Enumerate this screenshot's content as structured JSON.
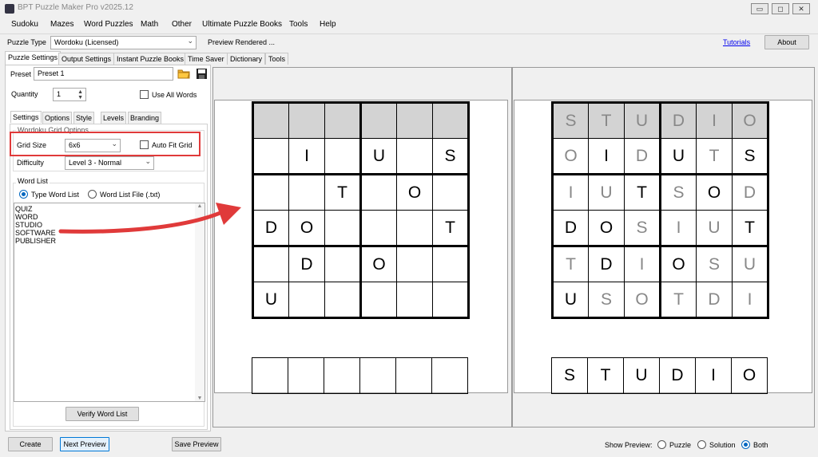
{
  "window": {
    "title": "BPT Puzzle Maker Pro v2025.12",
    "minimize": "▭",
    "maximize": "◻",
    "close": "✕"
  },
  "menu": [
    "Sudoku",
    "Mazes",
    "Word Puzzles",
    "Math",
    "Other",
    "Ultimate Puzzle Books",
    "Tools",
    "Help"
  ],
  "toolbar": {
    "puzzle_type_label": "Puzzle Type",
    "puzzle_type_value": "Wordoku (Licensed)",
    "preview_status": "Preview Rendered ...",
    "tutorials_link": "Tutorials",
    "about_button": "About"
  },
  "tabs": [
    "Puzzle Settings",
    "Output Settings",
    "Instant Puzzle Books",
    "Time Saver",
    "Dictionary",
    "Tools"
  ],
  "settings": {
    "preset_label": "Preset",
    "preset_value": "Preset 1",
    "quantity_label": "Quantity",
    "quantity_value": "1",
    "use_all_words": "Use All Words",
    "subtabs": [
      "Settings",
      "Options",
      "Style",
      "Levels",
      "Branding"
    ],
    "grid_options_title": "Wordoku Grid Options",
    "grid_size_label": "Grid Size",
    "grid_size_value": "6x6",
    "auto_fit_grid": "Auto Fit Grid",
    "difficulty_label": "Difficulty",
    "difficulty_value": "Level 3 - Normal",
    "word_list_title": "Word List",
    "type_word_list": "Type Word List",
    "word_list_file": "Word List File (.txt)",
    "words": [
      "QUIZ",
      "WORD",
      "STUDIO",
      "SOFTWARE",
      "PUBLISHER"
    ],
    "verify_button": "Verify Word List"
  },
  "puzzle": {
    "header_row": [
      "",
      "",
      "",
      "",
      "",
      ""
    ],
    "rows": [
      [
        "",
        "I",
        "",
        "U",
        "",
        "S"
      ],
      [
        "",
        "",
        "T",
        "",
        "O",
        ""
      ],
      [
        "D",
        "O",
        "",
        "",
        "",
        "T"
      ],
      [
        "",
        "D",
        "",
        "O",
        "",
        ""
      ],
      [
        "U",
        "",
        "",
        "",
        "",
        ""
      ]
    ],
    "answer_row": [
      "",
      "",
      "",
      "",
      "",
      ""
    ]
  },
  "solution": {
    "header_row": [
      "S",
      "T",
      "U",
      "D",
      "I",
      "O"
    ],
    "rows": [
      [
        "O",
        "I",
        "D",
        "U",
        "T",
        "S"
      ],
      [
        "I",
        "U",
        "T",
        "S",
        "O",
        "D"
      ],
      [
        "D",
        "O",
        "S",
        "I",
        "U",
        "T"
      ],
      [
        "T",
        "D",
        "I",
        "O",
        "S",
        "U"
      ],
      [
        "U",
        "S",
        "O",
        "T",
        "D",
        "I"
      ]
    ],
    "given_mask": [
      [
        0,
        1,
        0,
        1,
        0,
        1
      ],
      [
        0,
        0,
        1,
        0,
        1,
        0
      ],
      [
        1,
        1,
        0,
        0,
        0,
        1
      ],
      [
        0,
        1,
        0,
        1,
        0,
        0
      ],
      [
        1,
        0,
        0,
        0,
        0,
        0
      ]
    ],
    "answer_row": [
      "S",
      "T",
      "U",
      "D",
      "I",
      "O"
    ]
  },
  "bottom": {
    "create_button": "Create",
    "next_preview_button": "Next Preview",
    "save_preview_button": "Save Preview",
    "show_preview_label": "Show Preview:",
    "opt_puzzle": "Puzzle",
    "opt_solution": "Solution",
    "opt_both": "Both"
  },
  "colors": {
    "highlight_box": "#e03a3a",
    "arrow": "#e03a3a",
    "link": "#0000ee",
    "accent": "#0067c0"
  }
}
